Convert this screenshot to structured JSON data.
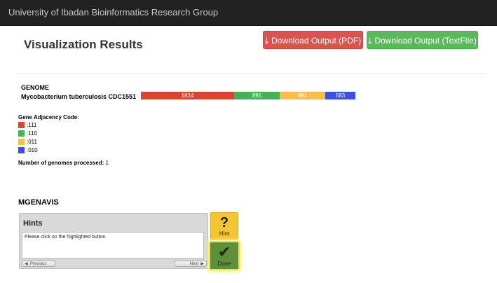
{
  "app": {
    "title": "University of Ibadan Bioinformatics Research Group"
  },
  "header": {
    "title": "Visualization Results",
    "download_pdf": "Download Output (PDF)",
    "download_text": "Download Output (TextFile)"
  },
  "colors": {
    "111": "#d94535",
    "110": "#4caf58",
    "011": "#f4bf50",
    "010": "#3e4fd8"
  },
  "genome": {
    "header": "GENOME",
    "name": "Mycobacterium tuberculosis CDC1551",
    "segments": [
      {
        "code": "111",
        "value": "1824"
      },
      {
        "code": "110",
        "value": "891"
      },
      {
        "code": "011",
        "value": "891"
      },
      {
        "code": "010",
        "value": "583"
      }
    ]
  },
  "legend": {
    "title": "Gene Adjacency Code:",
    "items": [
      {
        "code": "111",
        "label": ":111"
      },
      {
        "code": "110",
        "label": ":110"
      },
      {
        "code": "011",
        "label": ":011"
      },
      {
        "code": "010",
        "label": ":010"
      }
    ]
  },
  "processed": {
    "label": "Number of genomes processed:",
    "value": "1"
  },
  "mgenavis": {
    "title": "MGENAVIS",
    "hints_title": "Hints",
    "hint_message": "Please click on the highlighted button.",
    "previous": "Previous",
    "next": "Next",
    "hint_button": "Hint",
    "done_button": "Done"
  }
}
